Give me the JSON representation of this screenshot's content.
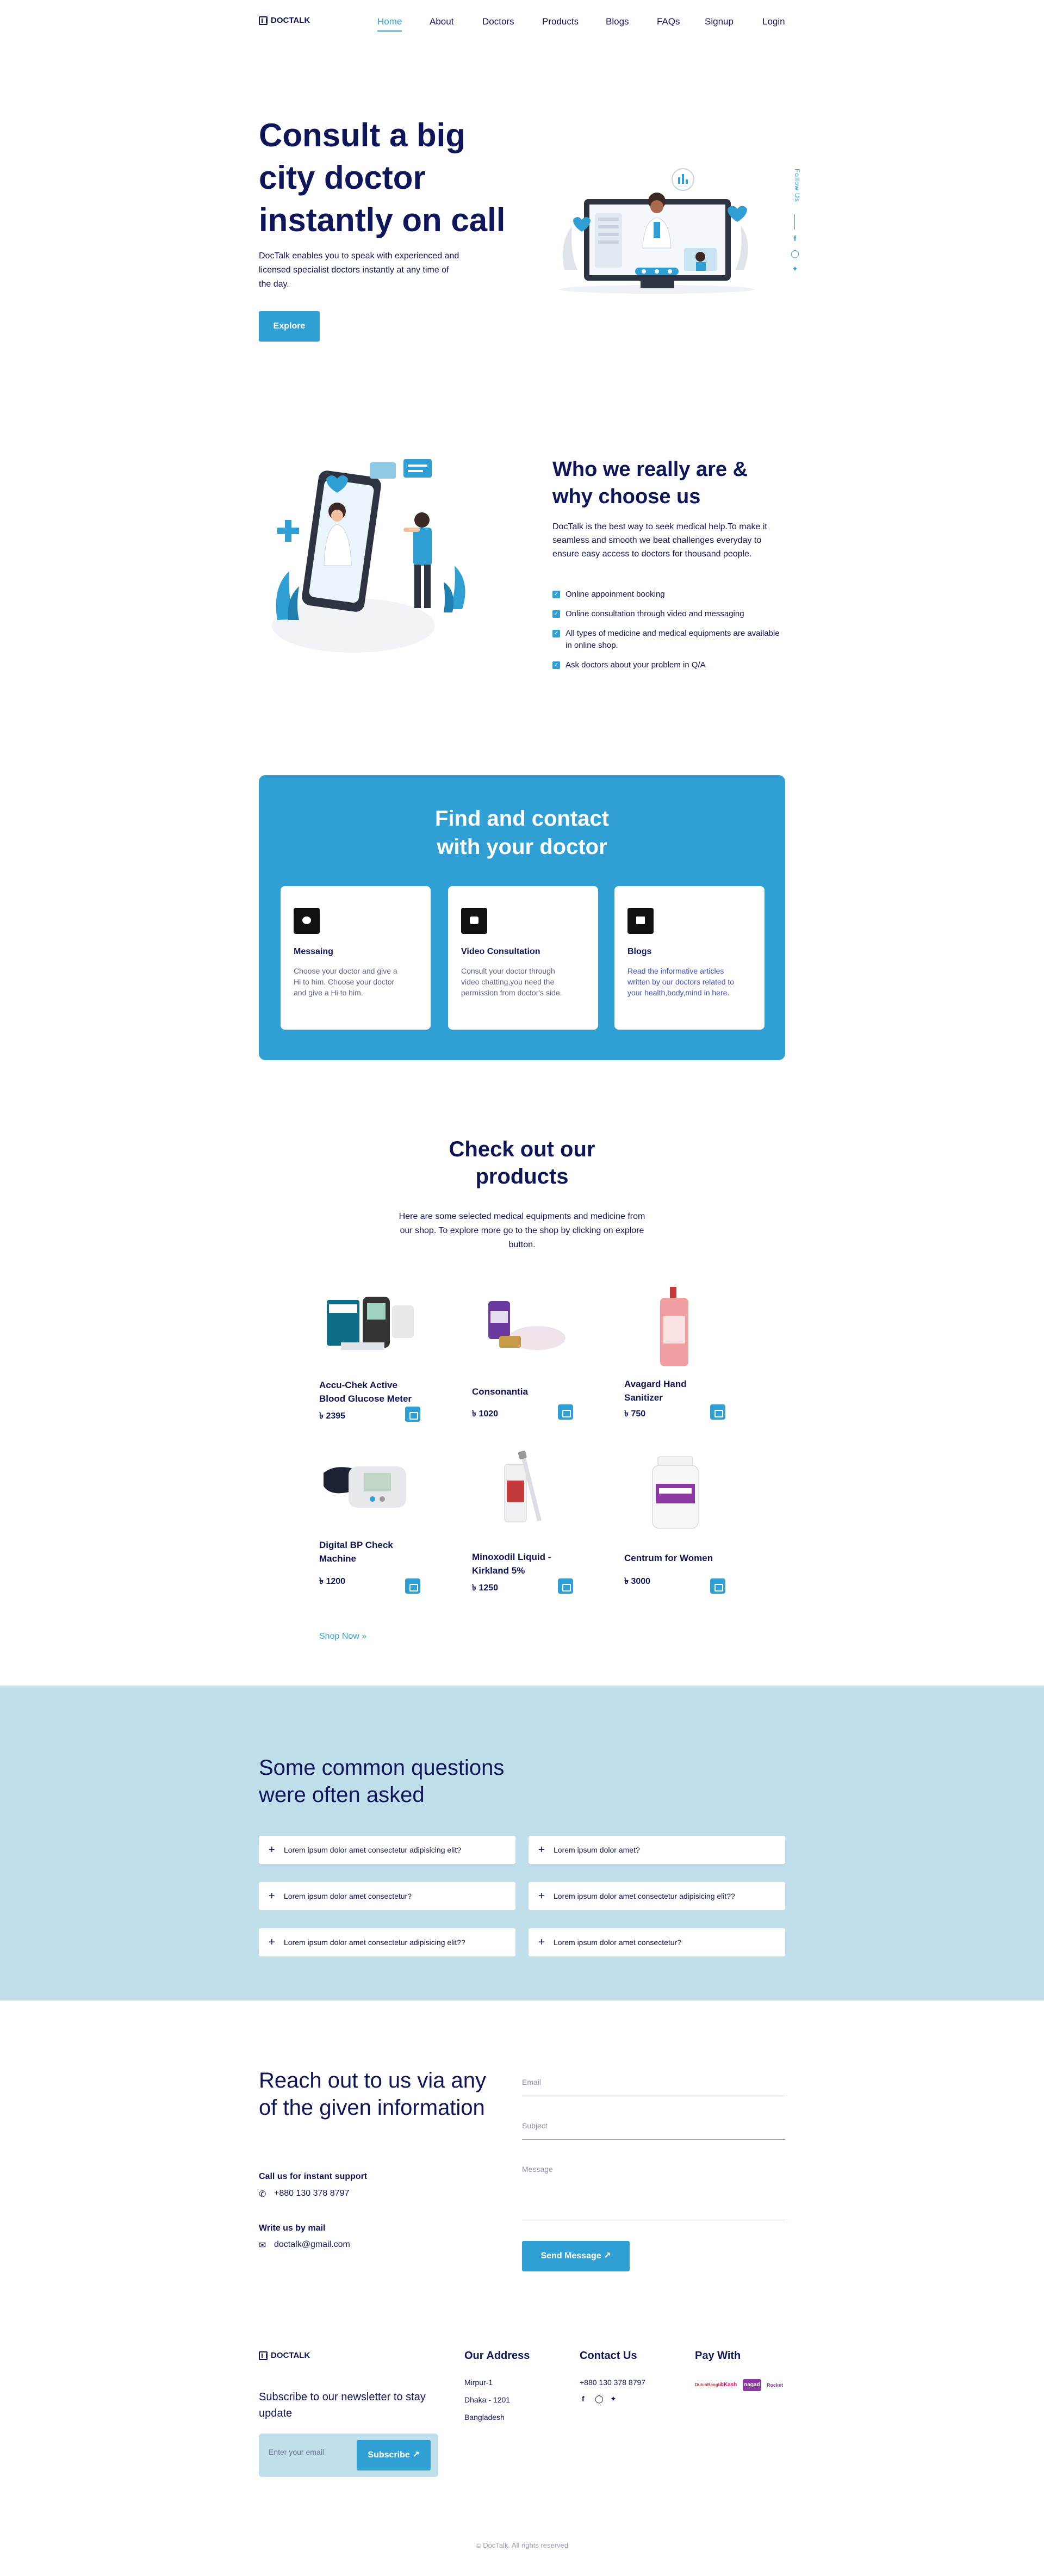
{
  "nav": {
    "brand": "DOCTALK",
    "items": [
      "Home",
      "About",
      "Doctors",
      "Products",
      "Blogs",
      "FAQs",
      "Signup",
      "Login"
    ]
  },
  "hero": {
    "title": "Consult a big city doctor instantly on call",
    "text": "DocTalk enables you to speak with experienced and licensed specialist doctors instantly at any time of the day.",
    "button": "Explore",
    "follow": "Follow Us"
  },
  "about": {
    "title": "Who we really are & why choose us",
    "text": "DocTalk is the best way to seek medical help.To make it seamless and smooth we beat challenges everyday to ensure easy access to doctors for thousand people.",
    "points": [
      "Online appoinment booking",
      "Online consultation through video and messaging",
      "All types of medicine and medical equipments are available in online shop.",
      "Ask doctors about your problem in Q/A"
    ]
  },
  "find": {
    "title": "Find and contact with your doctor",
    "cards": [
      {
        "title": "Messaing",
        "text": "Choose your doctor and give a Hi to him. Choose your doctor and give a Hi to him."
      },
      {
        "title": "Video Consultation",
        "text": "Consult your doctor through video chatting,you need the permission from doctor's side."
      },
      {
        "title": "Blogs",
        "text": "Read the informative articles written by our doctors related to your health,body,mind in here."
      }
    ]
  },
  "products": {
    "title": "Check out our products",
    "text": "Here are some selected medical equipments and medicine from our shop. To explore more go to the shop by clicking on explore button.",
    "currency": "৳",
    "items": [
      {
        "name": "Accu-Chek Active Blood Glucose Meter",
        "price": "2395"
      },
      {
        "name": "Consonantia",
        "price": "1020"
      },
      {
        "name": "Avagard Hand Sanitizer",
        "price": "750"
      },
      {
        "name": "Digital BP Check Machine",
        "price": "1200"
      },
      {
        "name": "Minoxodil Liquid - Kirkland 5%",
        "price": "1250"
      },
      {
        "name": "Centrum for Women",
        "price": "3000"
      }
    ],
    "shop_now": "Shop Now"
  },
  "faq": {
    "title": "Some common questions were often asked",
    "items": [
      "Lorem ipsum dolor amet consectetur adipisicing elit?",
      "Lorem ipsum dolor amet?",
      "Lorem ipsum dolor amet consectetur?",
      "Lorem ipsum dolor amet consectetur adipisicing elit??",
      "Lorem ipsum dolor amet consectetur adipisicing elit??",
      "Lorem ipsum dolor amet consectetur?"
    ]
  },
  "contact": {
    "title": "Reach out to us via any of the given information",
    "call_label": "Call us for instant support",
    "phone": "+880 130 378 8797",
    "mail_label": "Write us by mail",
    "email": "doctalk@gmail.com",
    "email_placeholder": "Email",
    "subject_placeholder": "Subject",
    "message_placeholder": "Message",
    "send": "Send Message"
  },
  "footer": {
    "brand": "DOCTALK",
    "newsletter": "Subscribe to our newsletter to stay update",
    "email_placeholder": "Enter your email",
    "subscribe": "Subscribe",
    "address_title": "Our Address",
    "address": [
      "Mirpur-1",
      "Dhaka - 1201",
      "Bangladesh"
    ],
    "contact_title": "Contact Us",
    "contact_phone": "+880 130 378 8797",
    "pay_title": "Pay With",
    "pay": [
      "DutchBangla",
      "bKash",
      "nagad",
      "Rocket"
    ],
    "copyright": "© DocTalk. All rights reserved"
  },
  "colors": {
    "primary": "#2f9fd4",
    "navy": "#0e1559",
    "faq_band": "#c1dfea"
  }
}
